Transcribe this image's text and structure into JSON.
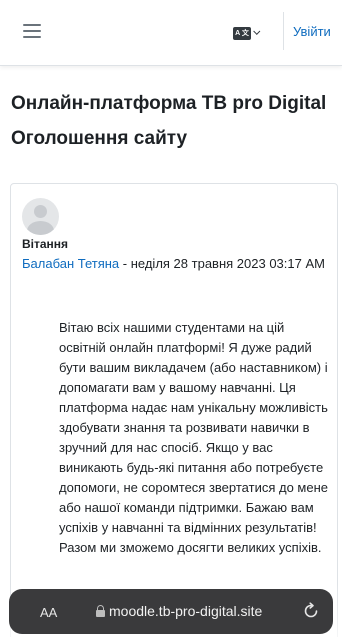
{
  "navbar": {
    "login_label": "Увійти",
    "lang_icon_text": "A 文"
  },
  "header": {
    "site_title": "Онлайн-платформа ТВ pro Digital",
    "page_title": "Оголошення сайту"
  },
  "post": {
    "subject": "Вітання",
    "author": "Балабан Тетяна",
    "date_text": " - неділя 28 травня 2023 03:17 AM",
    "message": "Вітаю всіх нашими студентами на цій освітній онлайн платформі! Я дуже радий бути вашим викладачем (або наставником) і допомагати вам у вашому навчанні. Ця платформа надає нам унікальну можливість здобувати знання та розвивати навички в зручний для нас спосіб. Якщо у вас виникають будь-які питання або потребуєте допомоги, не соромтеся звертатися до мене або нашої команди підтримки. Бажаю вам успіхів у навчанні та відмінних результатів! Разом ми зможемо досягти великих успіхів."
  },
  "browser": {
    "aa_label": "AA",
    "url": "moodle.tb-pro-digital.site"
  },
  "colors": {
    "link": "#0f6cbf",
    "text": "#1d2125",
    "urlbar": "#3a3a3c"
  },
  "icons": [
    "menu-icon",
    "language-icon",
    "user-avatar-icon",
    "lock-icon",
    "reload-icon"
  ]
}
